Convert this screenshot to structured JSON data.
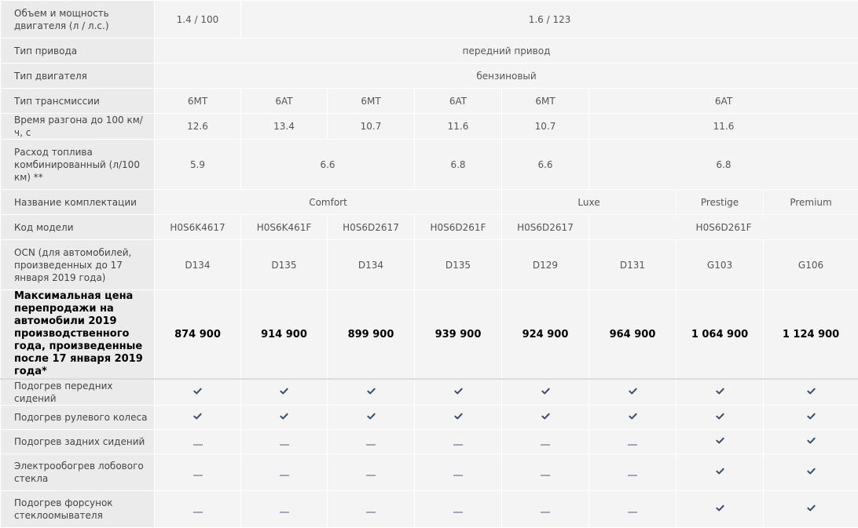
{
  "rows": {
    "engine": {
      "label": "Объем и мощность двигателя (л / л.с.)",
      "v1": "1.4 / 100",
      "v2": "1.6 / 123"
    },
    "drive": {
      "label": "Тип привода",
      "value": "передний привод"
    },
    "engine_type": {
      "label": "Тип двигателя",
      "value": "бензиновый"
    },
    "transmission": {
      "label": "Тип трансмиссии",
      "values": [
        "6MT",
        "6AT",
        "6MT",
        "6AT",
        "6MT",
        "6AT"
      ]
    },
    "accel": {
      "label": "Время разгона до 100 км/ч, с",
      "values": [
        "12.6",
        "13.4",
        "10.7",
        "11.6",
        "10.7",
        "11.6"
      ]
    },
    "fuel": {
      "label": "Расход топлива комбинированный (л/100 км) **",
      "values": [
        "5.9",
        "6.6",
        "6.8",
        "6.6",
        "6.8"
      ]
    },
    "trim": {
      "label": "Название комплектации",
      "values": [
        "Comfort",
        "Luxe",
        "Prestige",
        "Premium"
      ]
    },
    "model_code": {
      "label": "Код модели",
      "values": [
        "H0S6K4617",
        "H0S6K461F",
        "H0S6D2617",
        "H0S6D261F",
        "H0S6D2617",
        "H0S6D261F"
      ]
    },
    "ocn": {
      "label": "OCN (для автомобилей, произведенных до 17 января 2019 года)",
      "values": [
        "D134",
        "D135",
        "D134",
        "D135",
        "D129",
        "D131",
        "G103",
        "G106"
      ]
    },
    "price": {
      "label": "Максимальная цена перепродажи на автомобили 2019 производственного года, произведенные после 17 января 2019 года*",
      "values": [
        "874 900",
        "914 900",
        "899 900",
        "939 900",
        "924 900",
        "964 900",
        "1 064 900",
        "1 124 900"
      ]
    },
    "heated_front": {
      "label": "Подогрев передних сидений"
    },
    "heated_wheel": {
      "label": "Подогрев рулевого колеса"
    },
    "heated_rear": {
      "label": "Подогрев задних сидений"
    },
    "heated_windshield": {
      "label": "Электрообогрев лобового стекла"
    },
    "heated_washers": {
      "label": "Подогрев форсунок стеклоомывателя"
    }
  },
  "features": [
    {
      "key": "heated_front",
      "values": [
        true,
        true,
        true,
        true,
        true,
        true,
        true,
        true
      ]
    },
    {
      "key": "heated_wheel",
      "values": [
        true,
        true,
        true,
        true,
        true,
        true,
        true,
        true
      ]
    },
    {
      "key": "heated_rear",
      "values": [
        false,
        false,
        false,
        false,
        false,
        false,
        true,
        true
      ]
    },
    {
      "key": "heated_windshield",
      "values": [
        false,
        false,
        false,
        false,
        false,
        false,
        true,
        true
      ]
    },
    {
      "key": "heated_washers",
      "values": [
        false,
        false,
        false,
        false,
        false,
        false,
        true,
        true
      ]
    }
  ],
  "icons": {
    "included": "check-icon",
    "not_included": "dash-icon"
  },
  "colors": {
    "check": "#3b4f6b",
    "dash": "#9ea9b8",
    "label_bg": "#ebebeb",
    "value_bg": "#f4f4f4"
  }
}
